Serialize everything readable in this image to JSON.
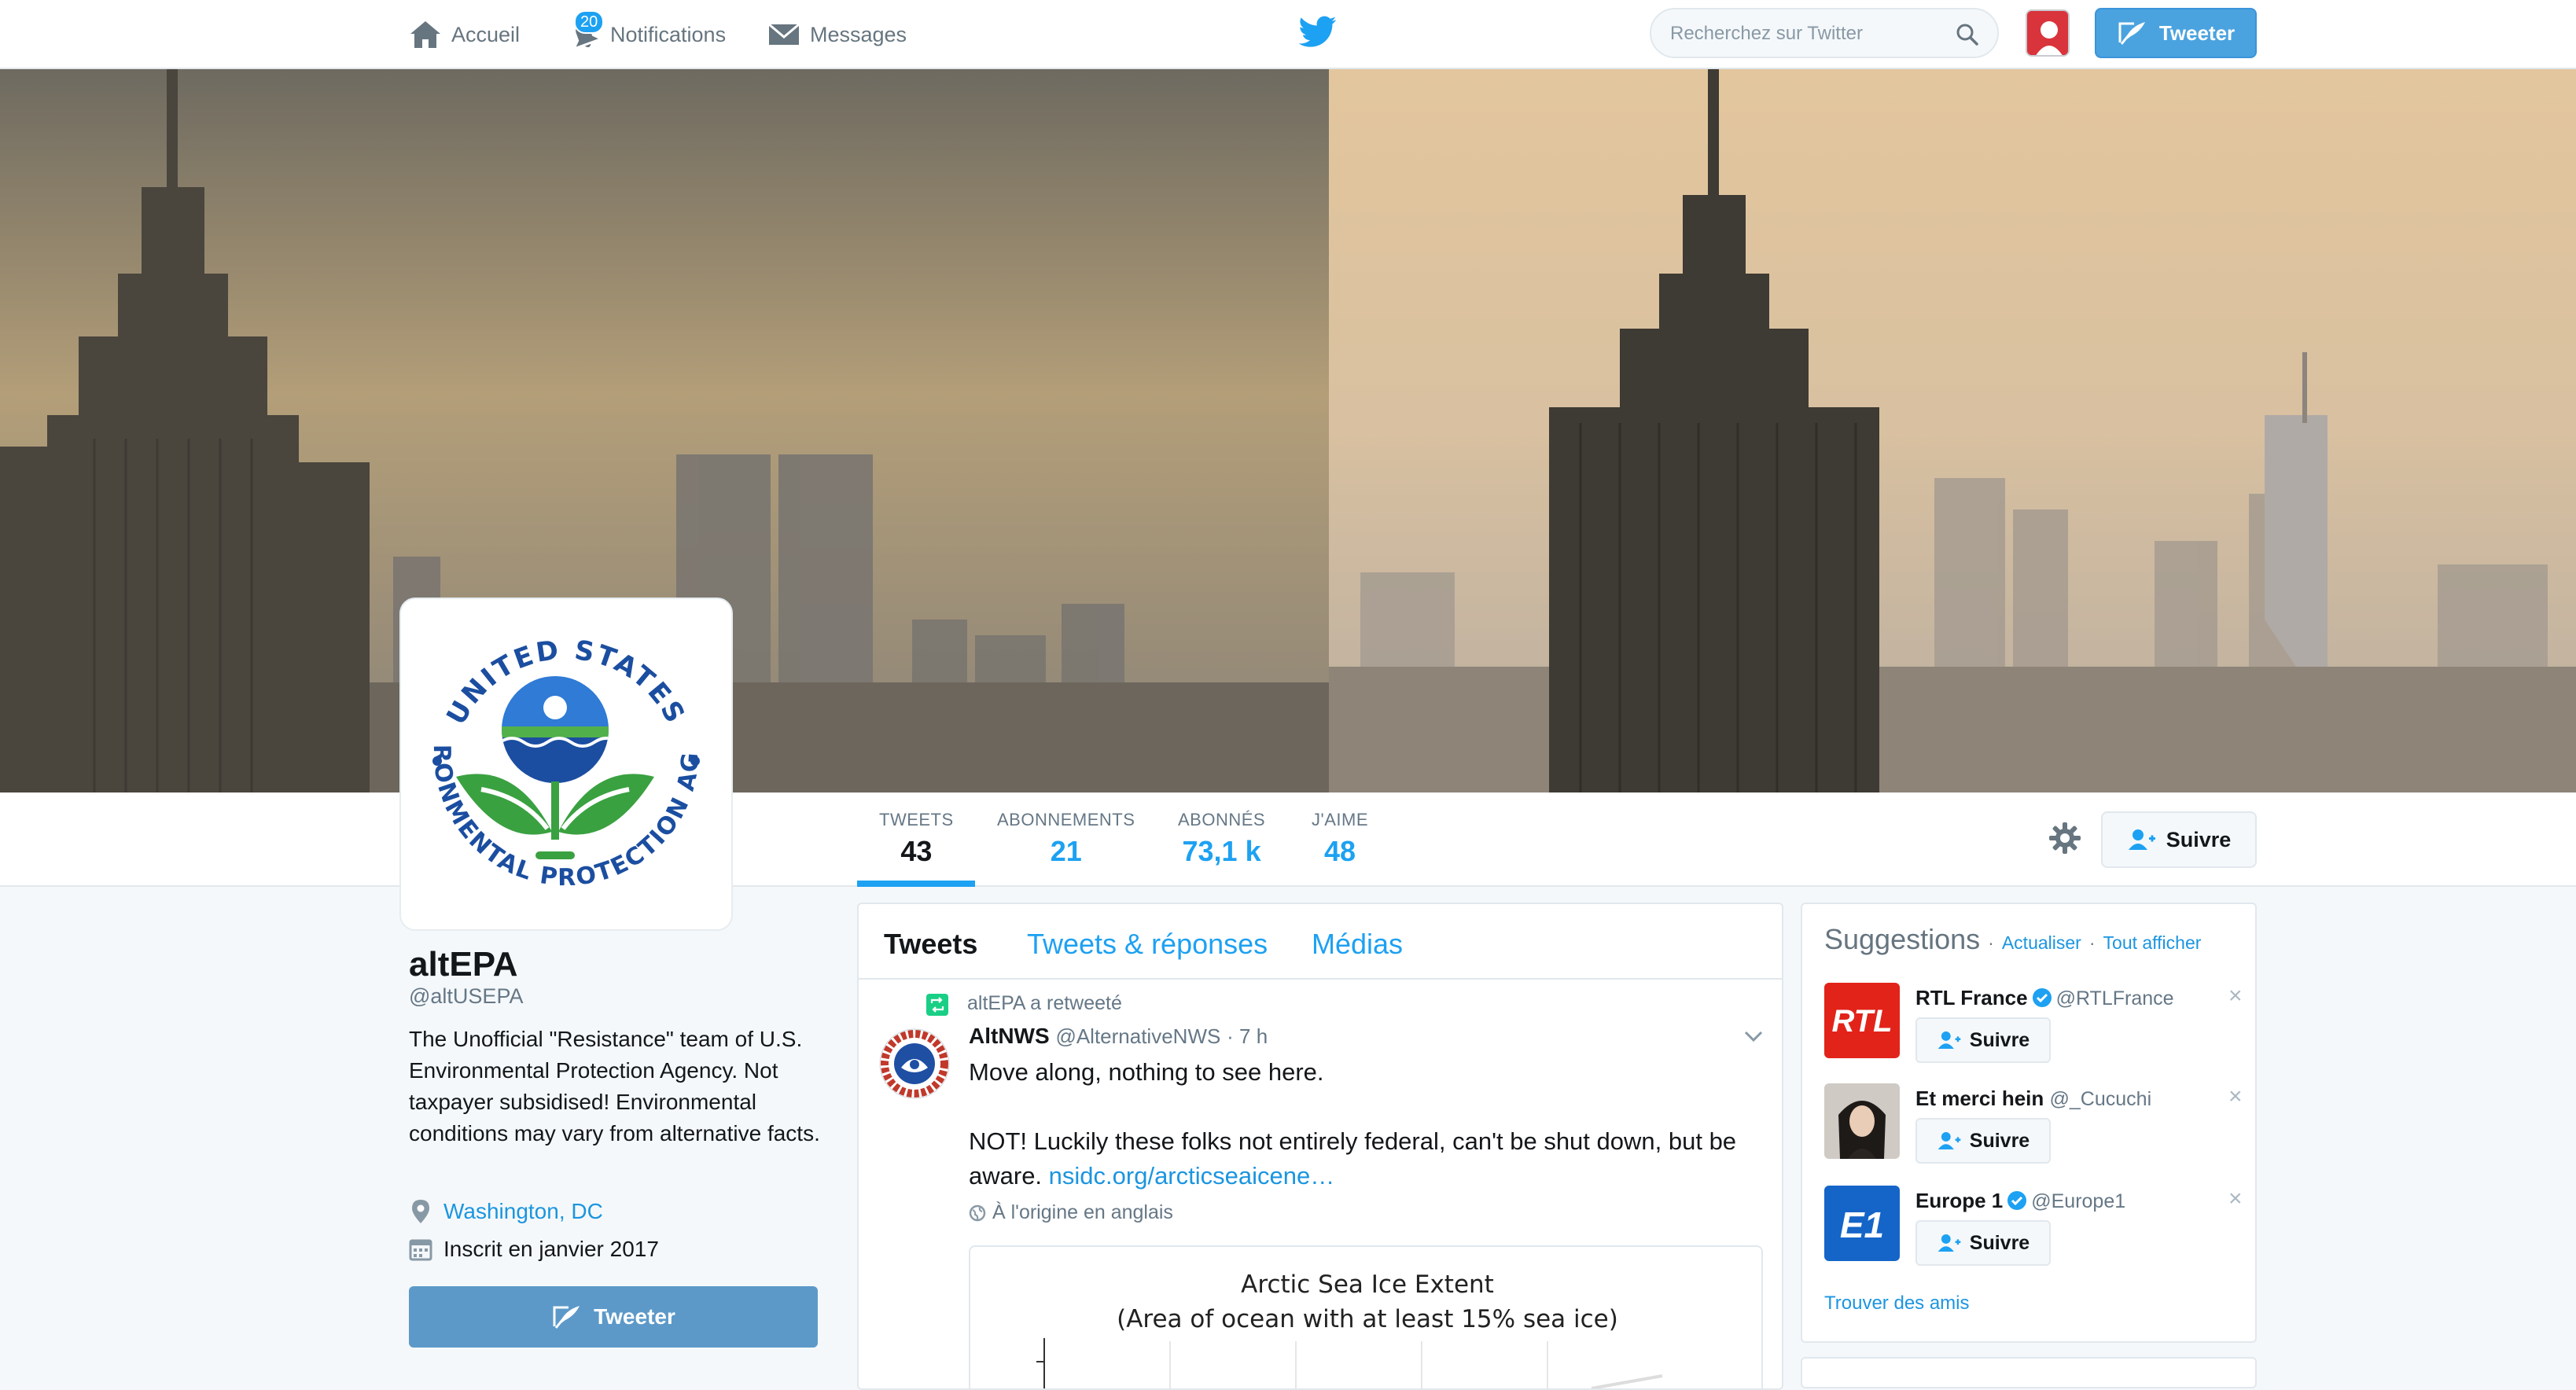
{
  "nav": {
    "home": "Accueil",
    "notifications": "Notifications",
    "notifications_count": "20",
    "messages": "Messages",
    "search_placeholder": "Recherchez sur Twitter",
    "tweet_button": "Tweeter"
  },
  "profile": {
    "name": "altEPA",
    "handle": "@altUSEPA",
    "bio": "The Unofficial \"Resistance\" team of U.S. Environmental Protection Agency. Not taxpayer subsidised! Environmental conditions may vary from alternative facts.",
    "location": "Washington, DC",
    "joined": "Inscrit en janvier 2017",
    "tweet_button": "Tweeter",
    "logo_text_top": "UNITED STATES",
    "logo_text_bottom": "ENVIRONMENTAL PROTECTION AGENCY"
  },
  "stats": [
    {
      "label": "TWEETS",
      "value": "43"
    },
    {
      "label": "ABONNEMENTS",
      "value": "21"
    },
    {
      "label": "ABONNÉS",
      "value": "73,1 k"
    },
    {
      "label": "J'AIME",
      "value": "48"
    }
  ],
  "follow_button": "Suivre",
  "timeline": {
    "tabs": [
      "Tweets",
      "Tweets & réponses",
      "Médias"
    ],
    "retweet_note": "altEPA a retweeté",
    "tweet": {
      "author_name": "AltNWS",
      "author_handle": "@AlternativeNWS",
      "time": "· 7 h",
      "text_1": "Move along, nothing to see here.",
      "text_2": "NOT!  Luckily these folks not entirely federal, can't be shut down, but be aware. ",
      "link": "nsidc.org/arcticseaicene…",
      "language": "À l'origine en anglais",
      "chart_title_1": "Arctic Sea Ice Extent",
      "chart_title_2": "(Area of ocean with at least 15% sea ice)"
    }
  },
  "suggestions": {
    "title": "Suggestions",
    "refresh": "Actualiser",
    "view_all": "Tout afficher",
    "separator": "·",
    "items": [
      {
        "name": "RTL France",
        "handle": "@RTLFrance",
        "verified": true,
        "follow": "Suivre",
        "avatar_text": "RTL"
      },
      {
        "name": "Et merci hein",
        "handle": "@_Cucuchi",
        "verified": false,
        "follow": "Suivre"
      },
      {
        "name": "Europe 1",
        "handle": "@Europe1",
        "verified": true,
        "follow": "Suivre",
        "avatar_text": "E1"
      }
    ],
    "find_friends": "Trouver des amis"
  },
  "colors": {
    "accent": "#1da1f2",
    "link": "#1b95e0",
    "tweet_button": "#4aa3df"
  }
}
